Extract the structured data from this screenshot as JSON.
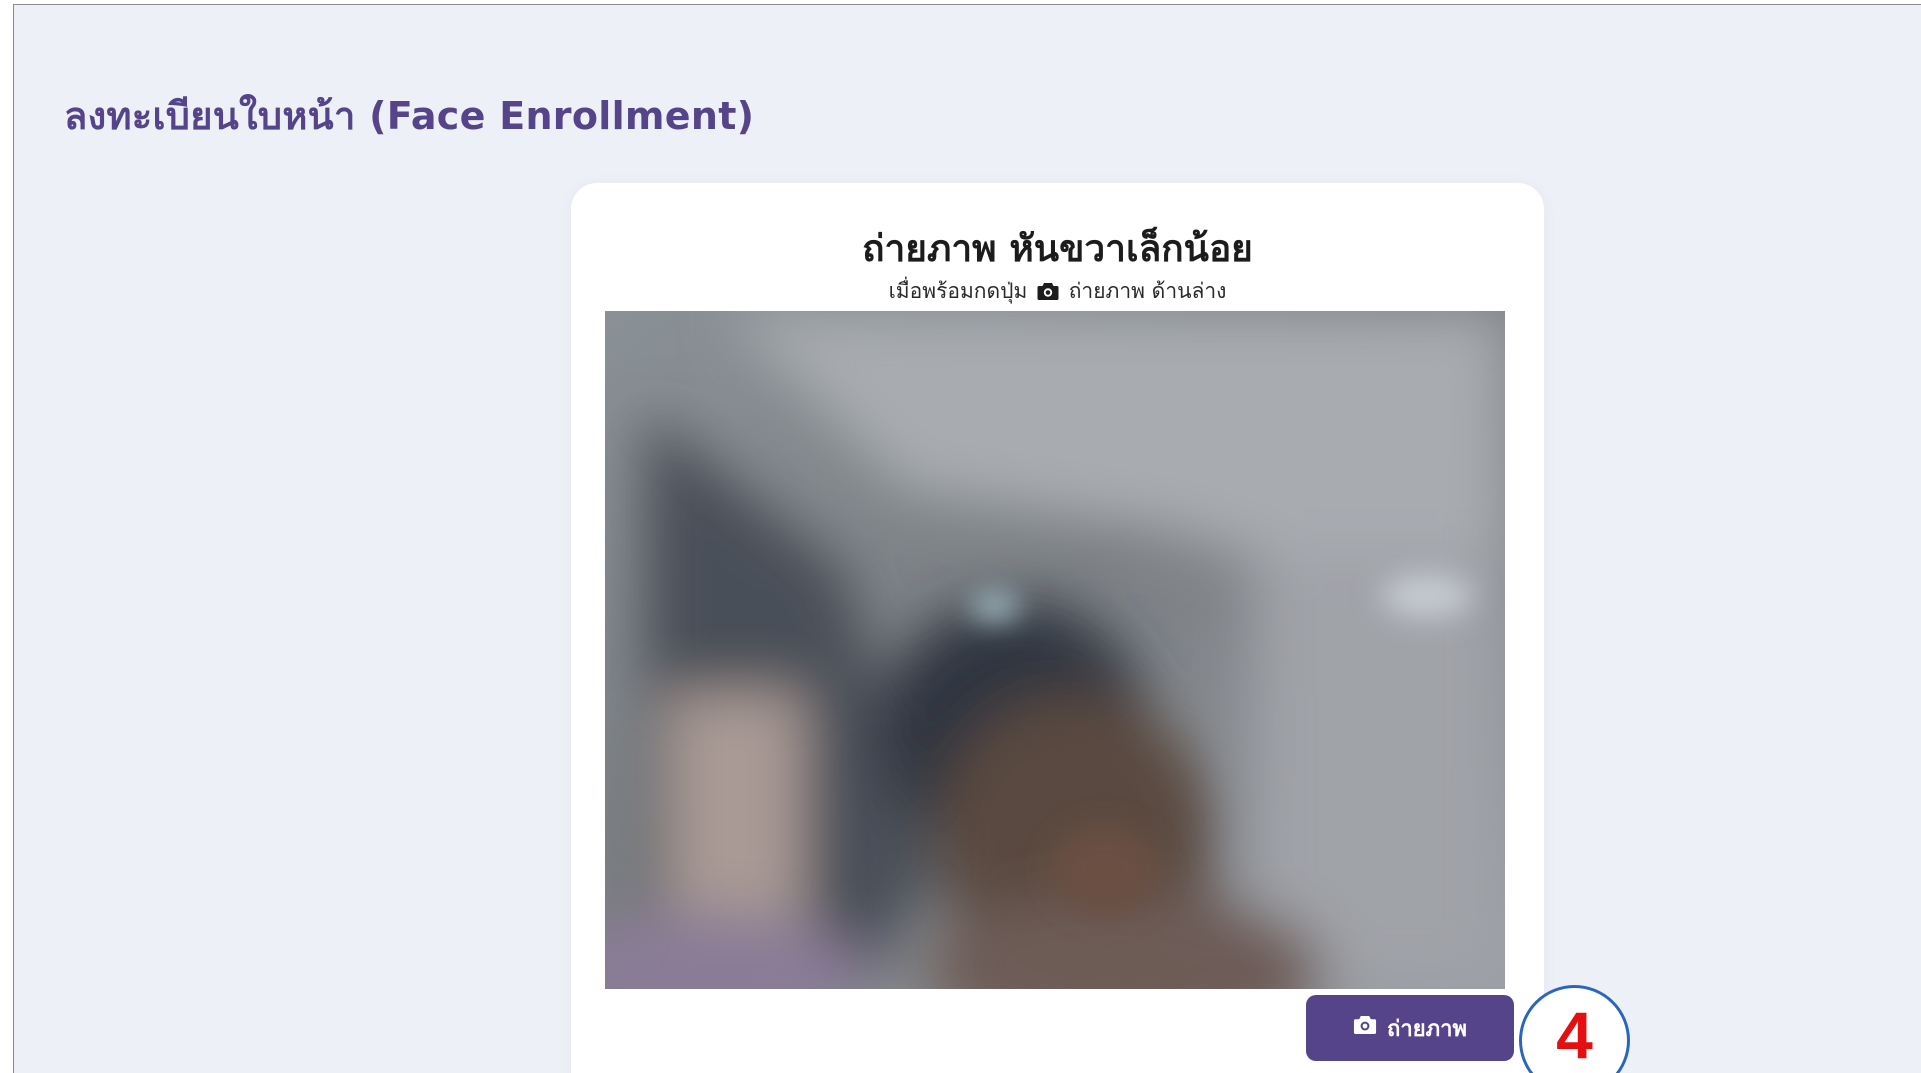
{
  "page": {
    "heading": "ลงทะเบียนใบหน้า (Face Enrollment)"
  },
  "card": {
    "title": "ถ่ายภาพ หันขวาเล็กน้อย",
    "hint_before_icon": "เมื่อพร้อมกดปุ่ม",
    "hint_icon": "camera-icon",
    "hint_after_icon": "ถ่ายภาพ ด้านล่าง",
    "capture_button": {
      "icon": "camera-icon",
      "label": "ถ่ายภาพ"
    }
  },
  "annotation": {
    "step_number": "4"
  },
  "colors": {
    "accent": "#55448a",
    "background": "#eef0f8",
    "card": "#ffffff",
    "marker_ring": "#2a66b9",
    "marker_number": "#e40f10"
  }
}
